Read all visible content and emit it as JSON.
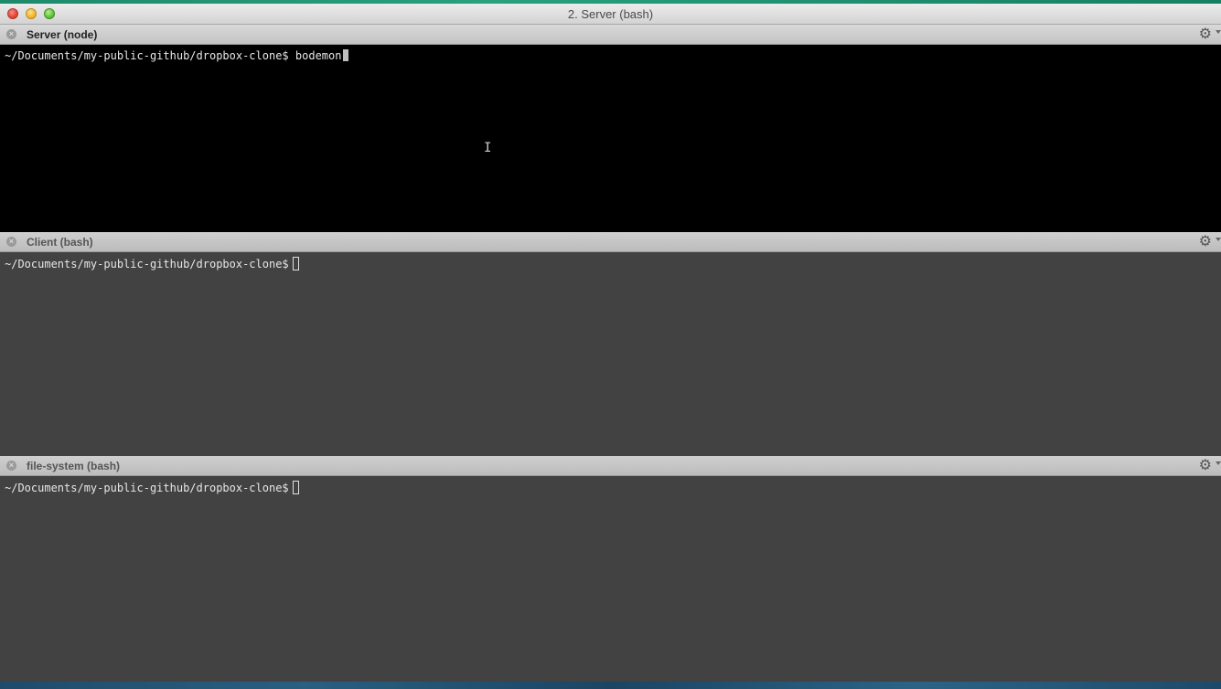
{
  "window": {
    "title": "2. Server (bash)"
  },
  "panes": [
    {
      "title": "Server (node)",
      "prompt": "~/Documents/my-public-github/dropbox-clone$",
      "command": "bodemon"
    },
    {
      "title": "Client (bash)",
      "prompt": "~/Documents/my-public-github/dropbox-clone$",
      "command": ""
    },
    {
      "title": "file-system (bash)",
      "prompt": "~/Documents/my-public-github/dropbox-clone$",
      "command": ""
    }
  ],
  "icons": {
    "close": "close-icon",
    "gear": "gear-icon",
    "cursor": "text-cursor-icon"
  },
  "colors": {
    "active_terminal_bg": "#000000",
    "inactive_terminal_bg": "#424242",
    "terminal_text": "#e6e6e6"
  }
}
